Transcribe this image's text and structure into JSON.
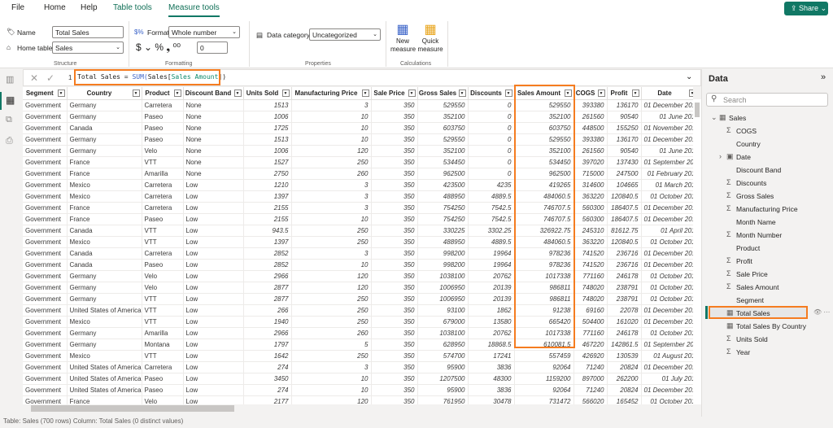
{
  "menu": {
    "file": "File",
    "home": "Home",
    "help": "Help",
    "table_tools": "Table tools",
    "measure_tools": "Measure tools",
    "share": "Share"
  },
  "ribbon": {
    "name_label": "Name",
    "name_value": "Total Sales",
    "home_table_label": "Home table",
    "home_table_value": "Sales",
    "structure": "Structure",
    "format_label": "Format",
    "format_value": "Whole number",
    "decimals_value": "0",
    "formatting": "Formatting",
    "data_category_label": "Data category",
    "data_category_value": "Uncategorized",
    "properties": "Properties",
    "new_measure": "New measure",
    "quick_measure": "Quick measure",
    "calculations": "Calculations"
  },
  "formula": {
    "line": "1",
    "name": "Total Sales = ",
    "func": "SUM(",
    "table": "Sales[",
    "column": "Sales Amount",
    "close": "])"
  },
  "columns": [
    "Segment",
    "Country",
    "Product",
    "Discount Band",
    "Units Sold",
    "Manufacturing Price",
    "Sale Price",
    "Gross Sales",
    "Discounts",
    "Sales Amount",
    "COGS",
    "Profit",
    "Date"
  ],
  "rows": [
    [
      "Government",
      "Germany",
      "Carretera",
      "None",
      "1513",
      "3",
      "350",
      "529550",
      "0",
      "529550",
      "393380",
      "136170",
      "01 December 201"
    ],
    [
      "Government",
      "Germany",
      "Paseo",
      "None",
      "1006",
      "10",
      "350",
      "352100",
      "0",
      "352100",
      "261560",
      "90540",
      "01 June 201"
    ],
    [
      "Government",
      "Canada",
      "Paseo",
      "None",
      "1725",
      "10",
      "350",
      "603750",
      "0",
      "603750",
      "448500",
      "155250",
      "01 November 201"
    ],
    [
      "Government",
      "Germany",
      "Paseo",
      "None",
      "1513",
      "10",
      "350",
      "529550",
      "0",
      "529550",
      "393380",
      "136170",
      "01 December 201"
    ],
    [
      "Government",
      "Germany",
      "Velo",
      "None",
      "1006",
      "120",
      "350",
      "352100",
      "0",
      "352100",
      "261560",
      "90540",
      "01 June 201"
    ],
    [
      "Government",
      "France",
      "VTT",
      "None",
      "1527",
      "250",
      "350",
      "534450",
      "0",
      "534450",
      "397020",
      "137430",
      "01 September 201"
    ],
    [
      "Government",
      "France",
      "Amarilla",
      "None",
      "2750",
      "260",
      "350",
      "962500",
      "0",
      "962500",
      "715000",
      "247500",
      "01 February 201"
    ],
    [
      "Government",
      "Mexico",
      "Carretera",
      "Low",
      "1210",
      "3",
      "350",
      "423500",
      "4235",
      "419265",
      "314600",
      "104665",
      "01 March 201"
    ],
    [
      "Government",
      "Mexico",
      "Carretera",
      "Low",
      "1397",
      "3",
      "350",
      "488950",
      "4889.5",
      "484060.5",
      "363220",
      "120840.5",
      "01 October 201"
    ],
    [
      "Government",
      "France",
      "Carretera",
      "Low",
      "2155",
      "3",
      "350",
      "754250",
      "7542.5",
      "746707.5",
      "560300",
      "186407.5",
      "01 December 201"
    ],
    [
      "Government",
      "France",
      "Paseo",
      "Low",
      "2155",
      "10",
      "350",
      "754250",
      "7542.5",
      "746707.5",
      "560300",
      "186407.5",
      "01 December 201"
    ],
    [
      "Government",
      "Canada",
      "VTT",
      "Low",
      "943.5",
      "250",
      "350",
      "330225",
      "3302.25",
      "326922.75",
      "245310",
      "81612.75",
      "01 April 201"
    ],
    [
      "Government",
      "Mexico",
      "VTT",
      "Low",
      "1397",
      "250",
      "350",
      "488950",
      "4889.5",
      "484060.5",
      "363220",
      "120840.5",
      "01 October 201"
    ],
    [
      "Government",
      "Canada",
      "Carretera",
      "Low",
      "2852",
      "3",
      "350",
      "998200",
      "19964",
      "978236",
      "741520",
      "236716",
      "01 December 201"
    ],
    [
      "Government",
      "Canada",
      "Paseo",
      "Low",
      "2852",
      "10",
      "350",
      "998200",
      "19964",
      "978236",
      "741520",
      "236716",
      "01 December 201"
    ],
    [
      "Government",
      "Germany",
      "Velo",
      "Low",
      "2966",
      "120",
      "350",
      "1038100",
      "20762",
      "1017338",
      "771160",
      "246178",
      "01 October 201"
    ],
    [
      "Government",
      "Germany",
      "Velo",
      "Low",
      "2877",
      "120",
      "350",
      "1006950",
      "20139",
      "986811",
      "748020",
      "238791",
      "01 October 201"
    ],
    [
      "Government",
      "Germany",
      "VTT",
      "Low",
      "2877",
      "250",
      "350",
      "1006950",
      "20139",
      "986811",
      "748020",
      "238791",
      "01 October 201"
    ],
    [
      "Government",
      "United States of America",
      "VTT",
      "Low",
      "266",
      "250",
      "350",
      "93100",
      "1862",
      "91238",
      "69160",
      "22078",
      "01 December 201"
    ],
    [
      "Government",
      "Mexico",
      "VTT",
      "Low",
      "1940",
      "250",
      "350",
      "679000",
      "13580",
      "665420",
      "504400",
      "161020",
      "01 December 201"
    ],
    [
      "Government",
      "Germany",
      "Amarilla",
      "Low",
      "2966",
      "260",
      "350",
      "1038100",
      "20762",
      "1017338",
      "771160",
      "246178",
      "01 October 201"
    ],
    [
      "Government",
      "Germany",
      "Montana",
      "Low",
      "1797",
      "5",
      "350",
      "628950",
      "18868.5",
      "610081.5",
      "467220",
      "142861.5",
      "01 September 201"
    ],
    [
      "Government",
      "Mexico",
      "VTT",
      "Low",
      "1642",
      "250",
      "350",
      "574700",
      "17241",
      "557459",
      "426920",
      "130539",
      "01 August 201"
    ],
    [
      "Government",
      "United States of America",
      "Carretera",
      "Low",
      "274",
      "3",
      "350",
      "95900",
      "3836",
      "92064",
      "71240",
      "20824",
      "01 December 201"
    ],
    [
      "Government",
      "United States of America",
      "Paseo",
      "Low",
      "3450",
      "10",
      "350",
      "1207500",
      "48300",
      "1159200",
      "897000",
      "262200",
      "01 July 201"
    ],
    [
      "Government",
      "United States of America",
      "Paseo",
      "Low",
      "274",
      "10",
      "350",
      "95900",
      "3836",
      "92064",
      "71240",
      "20824",
      "01 December 201"
    ],
    [
      "Government",
      "France",
      "Velo",
      "Low",
      "2177",
      "120",
      "350",
      "761950",
      "30478",
      "731472",
      "566020",
      "165452",
      "01 October 201"
    ]
  ],
  "status": "Table: Sales (700 rows) Column: Total Sales (0 distinct values)",
  "data_panel": {
    "title": "Data",
    "search_placeholder": "Search",
    "table": "Sales",
    "fields": [
      {
        "name": "COGS",
        "icon": "sigma"
      },
      {
        "name": "Country",
        "icon": ""
      },
      {
        "name": "Date",
        "icon": "calendar"
      },
      {
        "name": "Discount Band",
        "icon": ""
      },
      {
        "name": "Discounts",
        "icon": "sigma"
      },
      {
        "name": "Gross Sales",
        "icon": "sigma"
      },
      {
        "name": "Manufacturing Price",
        "icon": "sigma"
      },
      {
        "name": "Month Name",
        "icon": ""
      },
      {
        "name": "Month Number",
        "icon": "sigma"
      },
      {
        "name": "Product",
        "icon": ""
      },
      {
        "name": "Profit",
        "icon": "sigma"
      },
      {
        "name": "Sale Price",
        "icon": "sigma"
      },
      {
        "name": "Sales Amount",
        "icon": "sigma"
      },
      {
        "name": "Segment",
        "icon": ""
      },
      {
        "name": "Total Sales",
        "icon": "calculator"
      },
      {
        "name": "Total Sales By Country",
        "icon": "calculator"
      },
      {
        "name": "Units Sold",
        "icon": "sigma"
      },
      {
        "name": "Year",
        "icon": "sigma"
      }
    ]
  },
  "colors": {
    "accent": "#117865",
    "highlight": "#f57c20"
  }
}
